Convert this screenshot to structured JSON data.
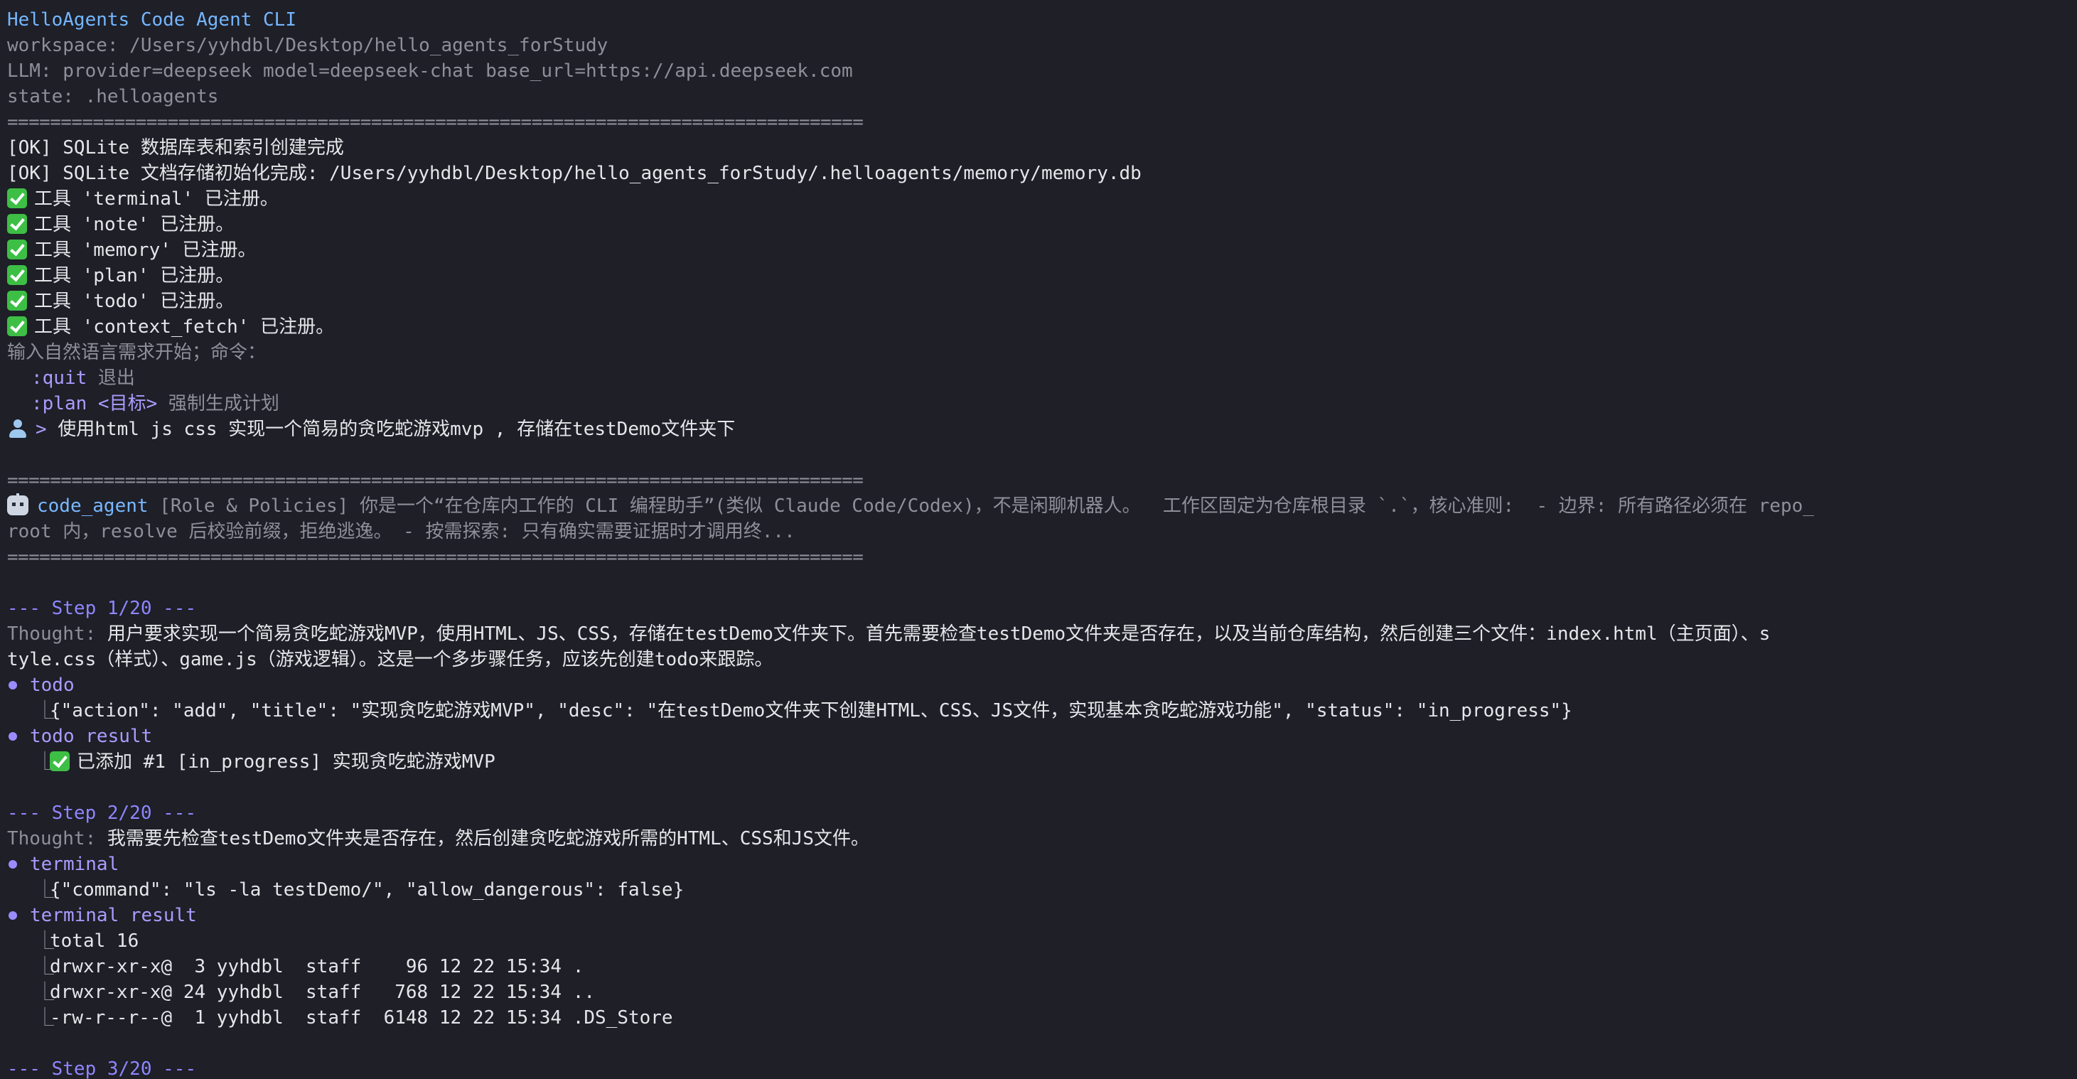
{
  "header": {
    "title": "HelloAgents Code Agent CLI",
    "workspace": "workspace: /Users/yyhdbl/Desktop/hello_agents_forStudy",
    "llm": "LLM: provider=deepseek model=deepseek-chat base_url=https://api.deepseek.com",
    "state": "state: .helloagents"
  },
  "separator": "================================================================================",
  "init_logs": [
    "[OK] SQLite 数据库表和索引创建完成",
    "[OK] SQLite 文档存储初始化完成: /Users/yyhdbl/Desktop/hello_agents_forStudy/.helloagents/memory/memory.db"
  ],
  "tool_registrations": [
    "工具 'terminal' 已注册。",
    "工具 'note' 已注册。",
    "工具 'memory' 已注册。",
    "工具 'plan' 已注册。",
    "工具 'todo' 已注册。",
    "工具 'context_fetch' 已注册。"
  ],
  "instructions": {
    "intro": "输入自然语言需求开始；命令：",
    "quit_cmd": ":quit",
    "quit_desc": " 退出",
    "plan_cmd": ":plan <目标>",
    "plan_desc": " 强制生成计划"
  },
  "user_prompt": {
    "arrow": ">",
    "text": " 使用html js css 实现一个简易的贪吃蛇游戏mvp , 存储在testDemo文件夹下"
  },
  "agent_header": {
    "name": "code_agent",
    "line1": " [Role & Policies] 你是一个“在仓库内工作的 CLI 编程助手”(类似 Claude Code/Codex)，不是闲聊机器人。  工作区固定为仓库根目录 `.`，核心准则:  - 边界: 所有路径必须在 repo_",
    "line2": "root 内，resolve 后校验前缀，拒绝逃逸。 - 按需探索: 只有确实需要证据时才调用终..."
  },
  "steps": [
    {
      "header": "--- Step 1/20 ---",
      "thought_label": "Thought:",
      "thought_line1": " 用户要求实现一个简易贪吃蛇游戏MVP，使用HTML、JS、CSS，存储在testDemo文件夹下。首先需要检查testDemo文件夹是否存在，以及当前仓库结构，然后创建三个文件：index.html（主页面）、s",
      "thought_line2": "tyle.css（样式）、game.js（游戏逻辑）。这是一个多步骤任务，应该先创建todo来跟踪。",
      "tool": "todo",
      "tool_args": "{\"action\": \"add\", \"title\": \"实现贪吃蛇游戏MVP\", \"desc\": \"在testDemo文件夹下创建HTML、CSS、JS文件，实现基本贪吃蛇游戏功能\", \"status\": \"in_progress\"}",
      "result_label": "todo result",
      "result_text": "已添加 #1 [in_progress] 实现贪吃蛇游戏MVP"
    },
    {
      "header": "--- Step 2/20 ---",
      "thought_label": "Thought:",
      "thought_line1": " 我需要先检查testDemo文件夹是否存在，然后创建贪吃蛇游戏所需的HTML、CSS和JS文件。",
      "tool": "terminal",
      "tool_args": "{\"command\": \"ls -la testDemo/\", \"allow_dangerous\": false}",
      "result_label": "terminal result",
      "result_lines": [
        "total 16",
        "drwxr-xr-x@  3 yyhdbl  staff    96 12 22 15:34 .",
        "drwxr-xr-x@ 24 yyhdbl  staff   768 12 22 15:34 ..",
        "-rw-r--r--@  1 yyhdbl  staff  6148 12 22 15:34 .DS_Store"
      ]
    },
    {
      "header": "--- Step 3/20 ---"
    }
  ],
  "icons": {
    "check": "check-icon",
    "user": "user-icon",
    "robot": "robot-icon",
    "bullet": "bullet-dot-icon"
  },
  "colors": {
    "background": "#1e1f27",
    "foreground": "#e6e6ea",
    "title": "#74b6ff",
    "dim": "#8e8f99",
    "accent_purple": "#a99cff",
    "check_green": "#3dbf45"
  }
}
